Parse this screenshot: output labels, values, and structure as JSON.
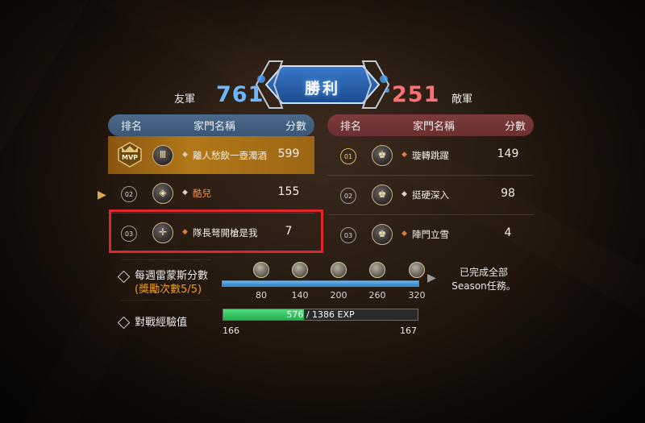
{
  "header": {
    "result_title": "勝利",
    "ally_label": "友軍",
    "enemy_label": "敵軍",
    "ally_score": "761",
    "enemy_score": "251"
  },
  "table_headers": {
    "rank": "排名",
    "family": "家門名稱",
    "score": "分數"
  },
  "ally_rows": [
    {
      "rank": "MVP",
      "name": "離人愁飲一壺濁酒",
      "score": "599",
      "emblem": "guild-emblem-icon"
    },
    {
      "rank": "02",
      "name": "酷兒",
      "score": "155",
      "emblem": "guild-emblem-icon"
    },
    {
      "rank": "03",
      "name": "隊長弩開槍是我",
      "score": "7",
      "emblem": "crossbow-emblem-icon"
    }
  ],
  "enemy_rows": [
    {
      "rank": "01",
      "name": "璇轉跳躍",
      "score": "149"
    },
    {
      "rank": "02",
      "name": "挺硬深入",
      "score": "98"
    },
    {
      "rank": "03",
      "name": "陣門立雪",
      "score": "4"
    }
  ],
  "weekly": {
    "label": "每週雷蒙斯分數",
    "reward": "(獎勵次數5/5)",
    "progress_fraction": 1.0,
    "ticks": [
      "80",
      "140",
      "200",
      "260",
      "320"
    ],
    "completed_text_1": "已完成全部",
    "completed_text_2": "Season任務。"
  },
  "exp": {
    "label": "對戰經驗值",
    "current": "576",
    "total": "/ 1386 EXP",
    "fill_fraction": 0.416,
    "level_from": "166",
    "level_to": "167"
  },
  "colors": {
    "ally_blue": "#6fb6ff",
    "enemy_red": "#ff6f78",
    "mvp_gold": "#b27818",
    "highlight_red": "#e0262b",
    "exp_green": "#26b050",
    "orange_name": "#ff8a3d"
  }
}
